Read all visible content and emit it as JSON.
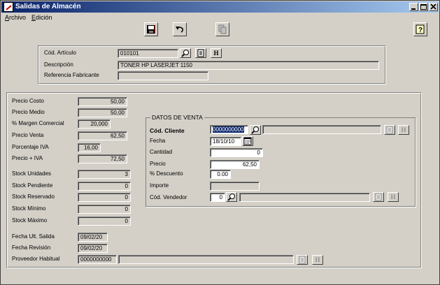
{
  "window": {
    "title": "Salidas de Almacén"
  },
  "menu": [
    {
      "label": "Archivo",
      "hot": "A",
      "rest": "rchivo"
    },
    {
      "label": "Edición",
      "hot": "E",
      "rest": "dición"
    }
  ],
  "articulo": {
    "cod_label": "Cód. Artículo",
    "cod_value": "010101",
    "desc_label": "Descripción",
    "desc_value": "TONER HP LASERJET 1150",
    "ref_label": "Referencia Fabricante",
    "ref_value": ""
  },
  "prices": {
    "precio_costo": {
      "label": "Precio Costo",
      "value": "50,00"
    },
    "precio_medio": {
      "label": "Precio Medio",
      "value": "50,00"
    },
    "margen": {
      "label": "% Margen Comercial",
      "value": "20,000"
    },
    "precio_venta": {
      "label": "Precio Venta",
      "value": "62,50"
    },
    "iva": {
      "label": "Porcentaje IVA",
      "value": "16,00"
    },
    "precio_iva": {
      "label": "Precio + IVA",
      "value": "72,50"
    }
  },
  "stock": {
    "unidades": {
      "label": "Stock Unidades",
      "value": "3"
    },
    "pendiente": {
      "label": "Stock Pendiente",
      "value": "0"
    },
    "reservado": {
      "label": "Stock Reservado",
      "value": "0"
    },
    "minimo": {
      "label": "Stock Mínimo",
      "value": "0"
    },
    "maximo": {
      "label": "Stock Máximo",
      "value": "0"
    }
  },
  "fechas": {
    "ult_salida": {
      "label": "Fecha Ult. Salida",
      "value": "09/02/20"
    },
    "revision": {
      "label": "Fecha Revisión",
      "value": "09/02/20"
    },
    "proveedor": {
      "label": "Proveedor Habitual",
      "value": "0000000000",
      "name": ""
    }
  },
  "venta": {
    "title": "DATOS DE VENTA",
    "cliente": {
      "label": "Cód. Cliente",
      "value": "0000000000",
      "name": ""
    },
    "fecha": {
      "label": "Fecha",
      "value": "18/10/10"
    },
    "cantidad": {
      "label": "Cantidad",
      "value": "0"
    },
    "precio": {
      "label": "Precio",
      "value": "62,50"
    },
    "descuento": {
      "label": "% Descuento",
      "value": "0.00"
    },
    "importe": {
      "label": "Importe",
      "value": ""
    },
    "vendedor": {
      "label": "Cód. Vendedor",
      "value": "0",
      "name": ""
    }
  },
  "buttons": {
    "h_label": "H"
  },
  "colors": {
    "title_start": "#0a246a",
    "title_end": "#a6caf0",
    "face": "#d4d0c8",
    "selection": "#0a246a"
  },
  "icons": [
    "save-icon",
    "undo-icon",
    "copy-icon",
    "help-icon",
    "search-icon",
    "notes-icon",
    "calendar-icon"
  ]
}
